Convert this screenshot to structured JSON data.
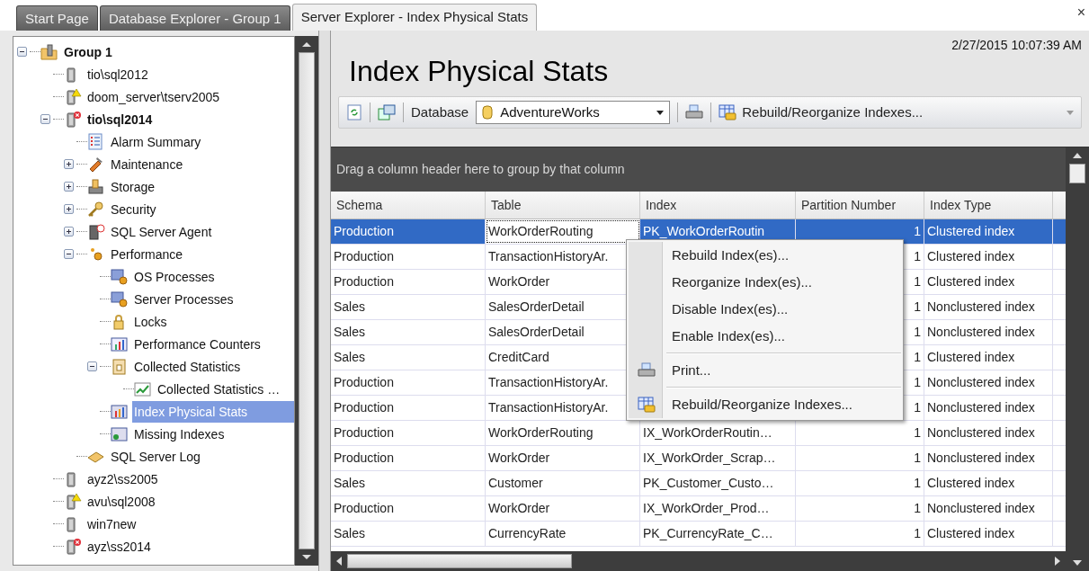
{
  "tabs": [
    {
      "label": "Start Page",
      "selected": false
    },
    {
      "label": "Database Explorer - Group 1",
      "selected": false
    },
    {
      "label": "Server Explorer - Index Physical Stats",
      "selected": true
    }
  ],
  "close_glyph": "×",
  "tree": [
    {
      "label": "Group 1",
      "kind": "group",
      "bold": true,
      "expanded": true,
      "selected": false,
      "children": [
        {
          "label": "tio\\sql2012",
          "kind": "server",
          "selected": false
        },
        {
          "label": "doom_server\\tserv2005",
          "kind": "server_warning",
          "selected": false
        },
        {
          "label": "tio\\sql2014",
          "kind": "server_error",
          "bold": true,
          "expanded": true,
          "selected": false,
          "children": [
            {
              "label": "Alarm Summary",
              "kind": "alarm",
              "selected": false
            },
            {
              "label": "Maintenance",
              "kind": "maintenance",
              "expanded": false,
              "selected": false
            },
            {
              "label": "Storage",
              "kind": "storage",
              "expanded": false,
              "selected": false
            },
            {
              "label": "Security",
              "kind": "security",
              "expanded": false,
              "selected": false
            },
            {
              "label": "SQL Server Agent",
              "kind": "agent",
              "expanded": false,
              "selected": false
            },
            {
              "label": "Performance",
              "kind": "performance",
              "expanded": true,
              "selected": false,
              "children": [
                {
                  "label": "OS Processes",
                  "kind": "processes",
                  "selected": false
                },
                {
                  "label": "Server Processes",
                  "kind": "processes",
                  "selected": false
                },
                {
                  "label": "Locks",
                  "kind": "locks",
                  "selected": false
                },
                {
                  "label": "Performance Counters",
                  "kind": "counters",
                  "selected": false
                },
                {
                  "label": "Collected Statistics",
                  "kind": "stats",
                  "expanded": true,
                  "selected": false,
                  "children": [
                    {
                      "label": "Collected Statistics …",
                      "kind": "chart",
                      "selected": false
                    }
                  ]
                },
                {
                  "label": "Index Physical Stats",
                  "kind": "index",
                  "selected": true
                },
                {
                  "label": "Missing Indexes",
                  "kind": "missing",
                  "selected": false
                }
              ]
            },
            {
              "label": "SQL Server Log",
              "kind": "log",
              "selected": false
            }
          ]
        },
        {
          "label": "ayz2\\ss2005",
          "kind": "server",
          "selected": false
        },
        {
          "label": "avu\\sql2008",
          "kind": "server_warning",
          "selected": false
        },
        {
          "label": "win7new",
          "kind": "server",
          "selected": false
        },
        {
          "label": "ayz\\ss2014",
          "kind": "server_error",
          "selected": false
        }
      ]
    }
  ],
  "page": {
    "title": "Index Physical Stats",
    "timestamp": "2/27/2015 10:07:39 AM"
  },
  "toolbar": {
    "database_label": "Database",
    "database_value": "AdventureWorks",
    "rebuild_button": "Rebuild/Reorganize Indexes..."
  },
  "table": {
    "group_panel": "Drag a column header here to group by that column",
    "columns": [
      "Schema",
      "Table",
      "Index",
      "Partition Number",
      "Index Type"
    ],
    "rows": [
      {
        "selected": true,
        "focused": true,
        "cells": [
          "Production",
          "WorkOrderRouting",
          "PK_WorkOrderRoutin",
          "1",
          "Clustered index"
        ]
      },
      {
        "selected": false,
        "focused": false,
        "cells": [
          "Production",
          "TransactionHistoryAr.",
          null,
          "1",
          "Clustered index"
        ]
      },
      {
        "selected": false,
        "focused": false,
        "cells": [
          "Production",
          "WorkOrder",
          null,
          "1",
          "Clustered index"
        ]
      },
      {
        "selected": false,
        "focused": false,
        "cells": [
          "Sales",
          "SalesOrderDetail",
          null,
          "1",
          "Nonclustered index"
        ]
      },
      {
        "selected": false,
        "focused": false,
        "cells": [
          "Sales",
          "SalesOrderDetail",
          null,
          "1",
          "Nonclustered index"
        ]
      },
      {
        "selected": false,
        "focused": false,
        "cells": [
          "Sales",
          "CreditCard",
          null,
          "1",
          "Clustered index"
        ]
      },
      {
        "selected": false,
        "focused": false,
        "cells": [
          "Production",
          "TransactionHistoryAr.",
          null,
          "1",
          "Nonclustered index"
        ]
      },
      {
        "selected": false,
        "focused": false,
        "cells": [
          "Production",
          "TransactionHistoryAr.",
          null,
          "1",
          "Nonclustered index"
        ]
      },
      {
        "selected": false,
        "focused": false,
        "cells": [
          "Production",
          "WorkOrderRouting",
          "IX_WorkOrderRoutin…",
          "1",
          "Nonclustered index"
        ]
      },
      {
        "selected": false,
        "focused": false,
        "cells": [
          "Production",
          "WorkOrder",
          "IX_WorkOrder_Scrap…",
          "1",
          "Nonclustered index"
        ]
      },
      {
        "selected": false,
        "focused": false,
        "cells": [
          "Sales",
          "Customer",
          "PK_Customer_Custo…",
          "1",
          "Clustered index"
        ]
      },
      {
        "selected": false,
        "focused": false,
        "cells": [
          "Production",
          "WorkOrder",
          "IX_WorkOrder_Prod…",
          "1",
          "Nonclustered index"
        ]
      },
      {
        "selected": false,
        "focused": false,
        "cells": [
          "Sales",
          "CurrencyRate",
          "PK_CurrencyRate_C…",
          "1",
          "Clustered index"
        ]
      }
    ]
  },
  "context_menu": [
    {
      "kind": "item",
      "label": "Rebuild Index(es)..."
    },
    {
      "kind": "item",
      "label": "Reorganize Index(es)..."
    },
    {
      "kind": "item",
      "label": "Disable Index(es)..."
    },
    {
      "kind": "item",
      "label": "Enable Index(es)..."
    },
    {
      "kind": "separator"
    },
    {
      "kind": "print_item",
      "label": "Print..."
    },
    {
      "kind": "separator"
    },
    {
      "kind": "rebuild_item",
      "label": "Rebuild/Reorganize Indexes..."
    }
  ]
}
